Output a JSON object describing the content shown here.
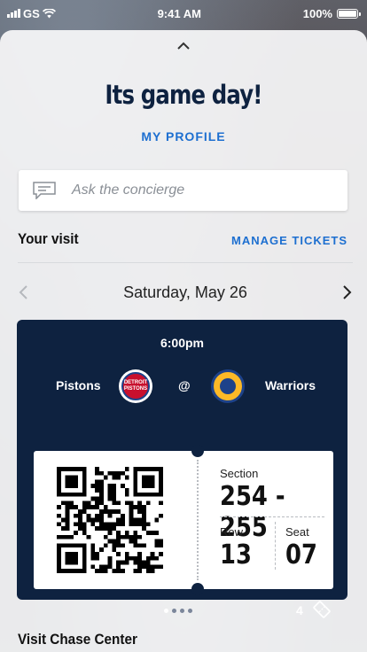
{
  "status_bar": {
    "carrier": "GS",
    "time": "9:41 AM",
    "battery": "100%"
  },
  "header": {
    "title": "Its game day!",
    "profile_link": "MY PROFILE"
  },
  "concierge": {
    "placeholder": "Ask the concierge"
  },
  "visit": {
    "title": "Your visit",
    "manage_link": "MANAGE TICKETS",
    "date": "Saturday, May 26"
  },
  "ticket": {
    "time": "6:00pm",
    "home_team": "Pistons",
    "separator": "@",
    "away_team": "Warriors",
    "home_logo_text": "DETROIT PISTONS",
    "section_label": "Section",
    "section": "254 - 255",
    "row_label": "Row",
    "row": "13",
    "seat_label": "Seat",
    "seat": "07",
    "ticket_count": "4",
    "page_index": 1,
    "page_total": 4
  },
  "footer": {
    "section_title": "Visit Chase Center"
  },
  "colors": {
    "navy": "#0e2240",
    "link_blue": "#1d6fd0",
    "pistons_red": "#c8102e",
    "warriors_gold": "#fdb927"
  }
}
